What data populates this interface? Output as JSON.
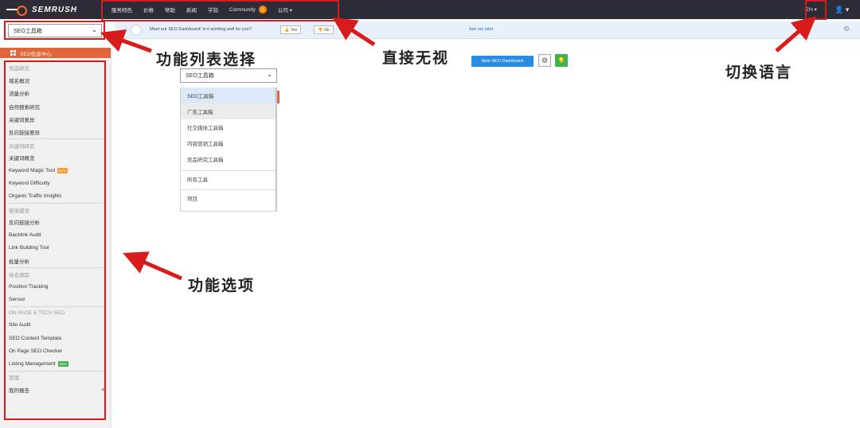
{
  "app": {
    "logo_text": "SEMRUSH"
  },
  "topnav": {
    "items": [
      "服务特色",
      "价格",
      "帮助",
      "新闻",
      "学院"
    ],
    "community_label": "Community",
    "community_badge": "1",
    "company_label": "公司 ▾"
  },
  "header_right": {
    "lang": "ZH ▾",
    "user": "👤 ▾"
  },
  "toolbox_select": {
    "value": "SEO工具箱"
  },
  "banner": {
    "text": "Meet our SEO Dashboard! Is it working well for you?",
    "yes": "Yes",
    "no": "No",
    "later": "Ask me later"
  },
  "sidebar": {
    "header": "SEO信息中心",
    "items": [
      {
        "label": "竞品研究",
        "type": "section"
      },
      {
        "label": "域名概况"
      },
      {
        "label": "流量分析"
      },
      {
        "label": "自然搜索研究"
      },
      {
        "label": "关键词差异"
      },
      {
        "label": "反向链接差异"
      },
      {
        "label": "关键词研究",
        "type": "section",
        "sep": true
      },
      {
        "label": "关键词概览"
      },
      {
        "label": "Keyword Magic Tool",
        "tag": "NEW"
      },
      {
        "label": "Keyword Difficulty"
      },
      {
        "label": "Organic Traffic Insights"
      },
      {
        "label": "链接建设",
        "type": "section",
        "sep": true
      },
      {
        "label": "反向链接分析"
      },
      {
        "label": "Backlink Audit"
      },
      {
        "label": "Link Building Tool"
      },
      {
        "label": "批量分析"
      },
      {
        "label": "排名跟踪",
        "type": "section",
        "sep": true
      },
      {
        "label": "Position Tracking"
      },
      {
        "label": "Sensor"
      },
      {
        "label": "ON PAGE & TECH SEO",
        "type": "section",
        "sep": true
      },
      {
        "label": "Site Audit"
      },
      {
        "label": "SEO Content Template"
      },
      {
        "label": "On Page SEO Checker"
      },
      {
        "label": "Listing Management",
        "tag": "NEW",
        "tag_color": "green"
      },
      {
        "label": "管理",
        "type": "section",
        "sep": true
      },
      {
        "label": "我的报告",
        "caret": "▾"
      }
    ]
  },
  "dropdown": {
    "selected": "SEO工具箱",
    "options": [
      {
        "label": "SEO工具箱",
        "state": "active"
      },
      {
        "label": "广告工具箱",
        "state": "hover"
      },
      {
        "label": "社交媒体工具箱"
      },
      {
        "label": "内容营销工具箱"
      },
      {
        "label": "竞品研究工具箱"
      },
      {
        "label": "所有工具",
        "divider": true
      },
      {
        "label": "项目",
        "divider": true
      }
    ]
  },
  "dashboard": {
    "new_button": "New SEO Dashboard",
    "gear_icon": "gear-icon",
    "bulb_icon": "lightbulb-icon"
  },
  "annotations": {
    "feature_list_select": "功能列表选择",
    "ignore": "直接无视",
    "switch_language": "切换语言",
    "feature_options": "功能选项"
  },
  "colors": {
    "topbar": "#2b2c36",
    "accent": "#e0663b",
    "annotation_red": "#d81c1c",
    "primary_button": "#2a8ce0"
  }
}
